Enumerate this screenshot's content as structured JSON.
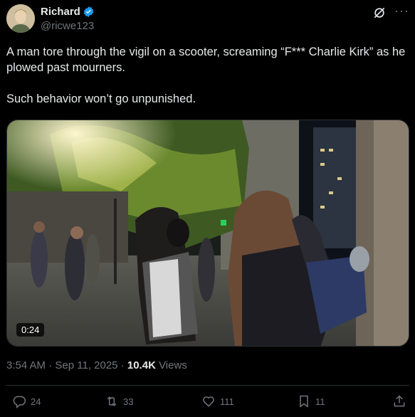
{
  "author": {
    "name": "Richard",
    "handle": "@ricwe123"
  },
  "post": {
    "paragraphs": [
      "A man tore through the vigil on a scooter, screaming “F*** Charlie Kirk” as he plowed past mourners.",
      "Such behavior won’t go unpunished."
    ],
    "video_duration": "0:24",
    "time": "3:54 AM",
    "date": "Sep 11, 2025",
    "views_count": "10.4K",
    "views_label": "Views"
  },
  "actions": {
    "replies": "24",
    "reposts": "33",
    "likes": "111",
    "bookmarks": "11"
  },
  "colors": {
    "background": "#000000",
    "text": "#e7e9ea",
    "muted": "#71767b",
    "verified": "#1d9bf0"
  },
  "icons": [
    "verified-badge-icon",
    "grok-icon",
    "more-icon",
    "reply-icon",
    "repost-icon",
    "like-icon",
    "bookmark-icon",
    "share-icon"
  ]
}
